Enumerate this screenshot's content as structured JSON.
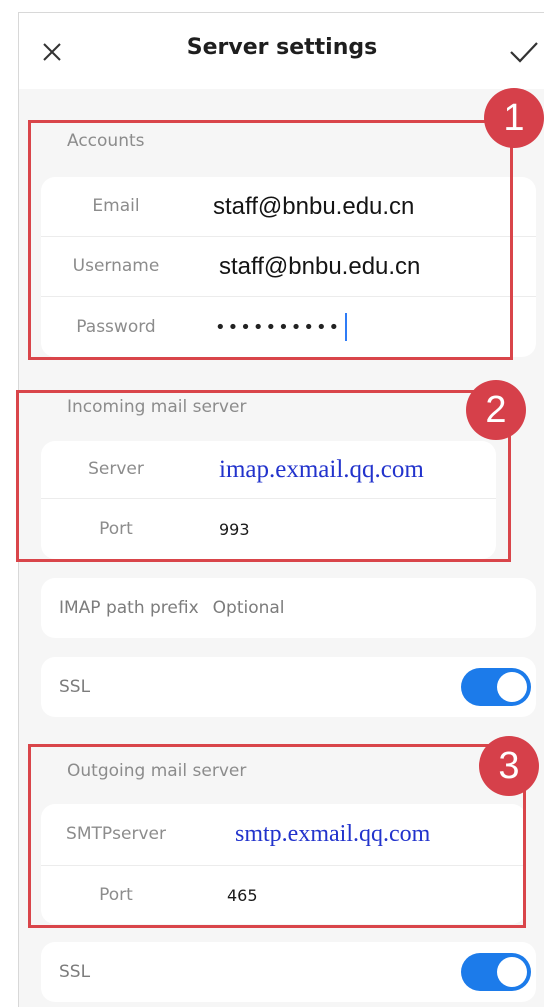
{
  "header": {
    "title": "Server settings",
    "close_icon": "close-icon",
    "confirm_icon": "checkmark-icon"
  },
  "accounts": {
    "section_label": "Accounts",
    "rows": [
      {
        "label": "Email",
        "value": "staff@bnbu.edu.cn"
      },
      {
        "label": "Username",
        "value": "staff@bnbu.edu.cn"
      },
      {
        "label": "Password",
        "value": "••••••••••"
      }
    ]
  },
  "incoming": {
    "section_label": "Incoming mail server",
    "rows": [
      {
        "label": "Server",
        "value": "imap.exmail.qq.com"
      },
      {
        "label": "Port",
        "value": "993"
      }
    ]
  },
  "imap_prefix": {
    "label": "IMAP path prefix",
    "placeholder": "Optional"
  },
  "incoming_ssl": {
    "label": "SSL",
    "enabled": true
  },
  "outgoing": {
    "section_label": "Outgoing mail server",
    "rows": [
      {
        "label_line1": "SMTP",
        "label_line2": "server",
        "value": "smtp.exmail.qq.com"
      },
      {
        "label": "Port",
        "value": "465"
      }
    ]
  },
  "outgoing_ssl": {
    "label": "SSL",
    "enabled": true
  },
  "annotations": {
    "badges": [
      "1",
      "2",
      "3"
    ]
  },
  "colors": {
    "accent": "#1c7bea",
    "annotation_red": "#d6404a",
    "server_text_blue": "#2233cc"
  }
}
